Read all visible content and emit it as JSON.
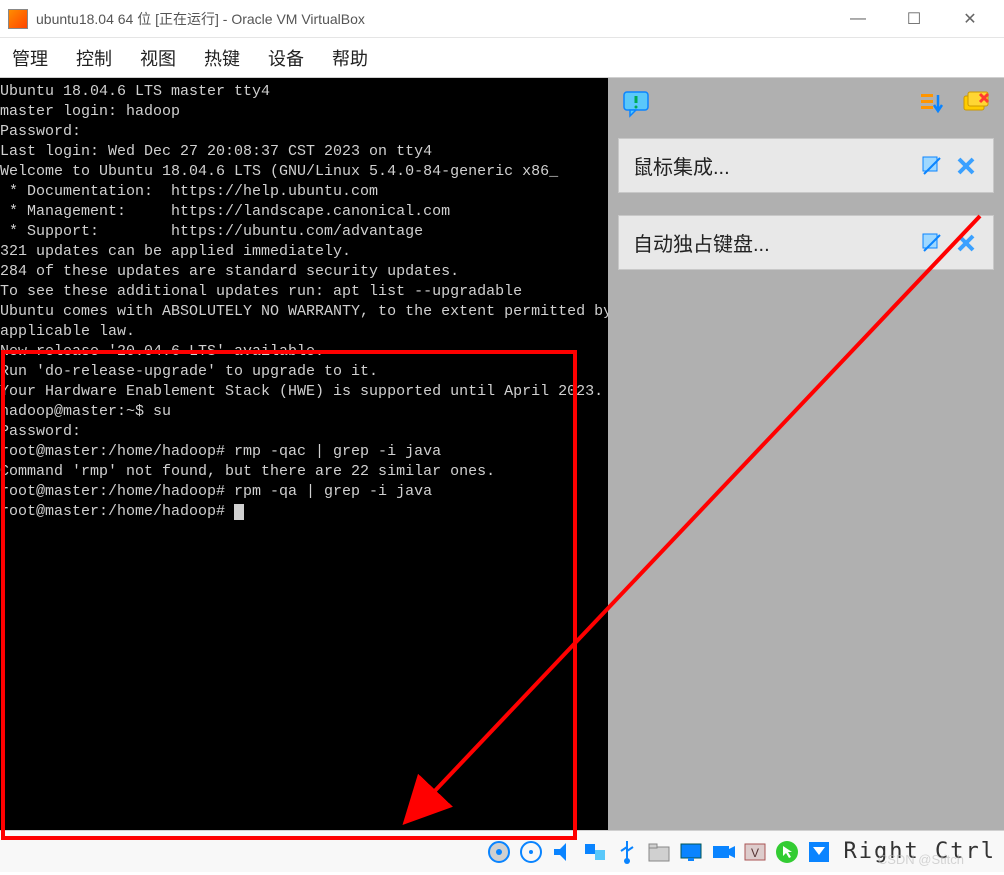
{
  "window": {
    "title": "ubuntu18.04 64 位 [正在运行] - Oracle VM VirtualBox"
  },
  "menu": {
    "items": [
      "管理",
      "控制",
      "视图",
      "热键",
      "设备",
      "帮助"
    ]
  },
  "terminal": {
    "lines": [
      "Ubuntu 18.04.6 LTS master tty4",
      "",
      "master login: hadoop",
      "Password:",
      "Last login: Wed Dec 27 20:08:37 CST 2023 on tty4",
      "Welcome to Ubuntu 18.04.6 LTS (GNU/Linux 5.4.0-84-generic x86_",
      "",
      " * Documentation:  https://help.ubuntu.com",
      " * Management:     https://landscape.canonical.com",
      " * Support:        https://ubuntu.com/advantage",
      "",
      "321 updates can be applied immediately.",
      "284 of these updates are standard security updates.",
      "To see these additional updates run: apt list --upgradable",
      "",
      "Ubuntu comes with ABSOLUTELY NO WARRANTY, to the extent permitted by",
      "applicable law.",
      "",
      "New release '20.04.6 LTS' available.",
      "Run 'do-release-upgrade' to upgrade to it.",
      "",
      "Your Hardware Enablement Stack (HWE) is supported until April 2023.",
      "hadoop@master:~$ su",
      "Password:",
      "root@master:/home/hadoop# rmp -qac | grep -i java",
      "",
      "Command 'rmp' not found, but there are 22 similar ones.",
      "",
      "root@master:/home/hadoop# rpm -qa | grep -i java",
      "root@master:/home/hadoop# "
    ]
  },
  "notifications": {
    "items": [
      {
        "text": "鼠标集成..."
      },
      {
        "text": "自动独占键盘..."
      }
    ]
  },
  "statusbar": {
    "host_key": "Right Ctrl"
  },
  "watermark": "CSDN @Stitch"
}
